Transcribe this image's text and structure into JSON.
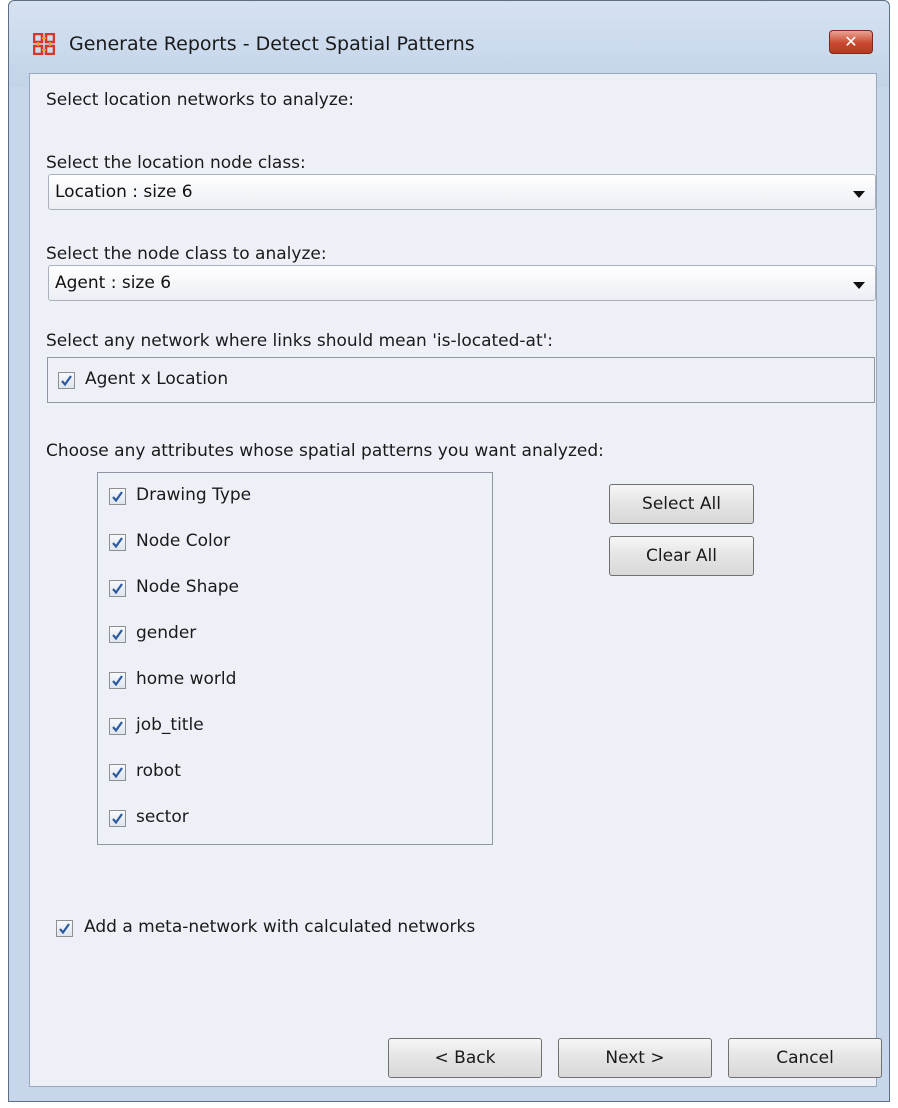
{
  "window": {
    "title": "Generate Reports - Detect Spatial Patterns",
    "close_label": "✕"
  },
  "intro_label": "Select location networks to analyze:",
  "location_class": {
    "label": "Select the location node class:",
    "selected": "Location : size 6"
  },
  "analyze_class": {
    "label": "Select the node class to analyze:",
    "selected": "Agent : size 6"
  },
  "networks": {
    "label": "Select any network where links should mean 'is-located-at':",
    "items": [
      {
        "label": "Agent x Location",
        "checked": true
      }
    ]
  },
  "attributes": {
    "label": "Choose any attributes whose spatial patterns you want analyzed:",
    "items": [
      {
        "label": "Drawing Type",
        "checked": true
      },
      {
        "label": "Node Color",
        "checked": true
      },
      {
        "label": "Node Shape",
        "checked": true
      },
      {
        "label": "gender",
        "checked": true
      },
      {
        "label": "home world",
        "checked": true
      },
      {
        "label": "job_title",
        "checked": true
      },
      {
        "label": "robot",
        "checked": true
      },
      {
        "label": "sector",
        "checked": true
      }
    ],
    "select_all_label": "Select All",
    "clear_all_label": "Clear All"
  },
  "meta_network": {
    "label": "Add a meta-network with calculated networks",
    "checked": true
  },
  "footer": {
    "back_label": "< Back",
    "next_label": "Next >",
    "cancel_label": "Cancel"
  },
  "colors": {
    "window_frame": "#c7d6ea",
    "panel": "#eef0f7",
    "checkmark": "#2c5aa0",
    "close_button": "#c9492f",
    "app_icon": "#d8342a"
  }
}
